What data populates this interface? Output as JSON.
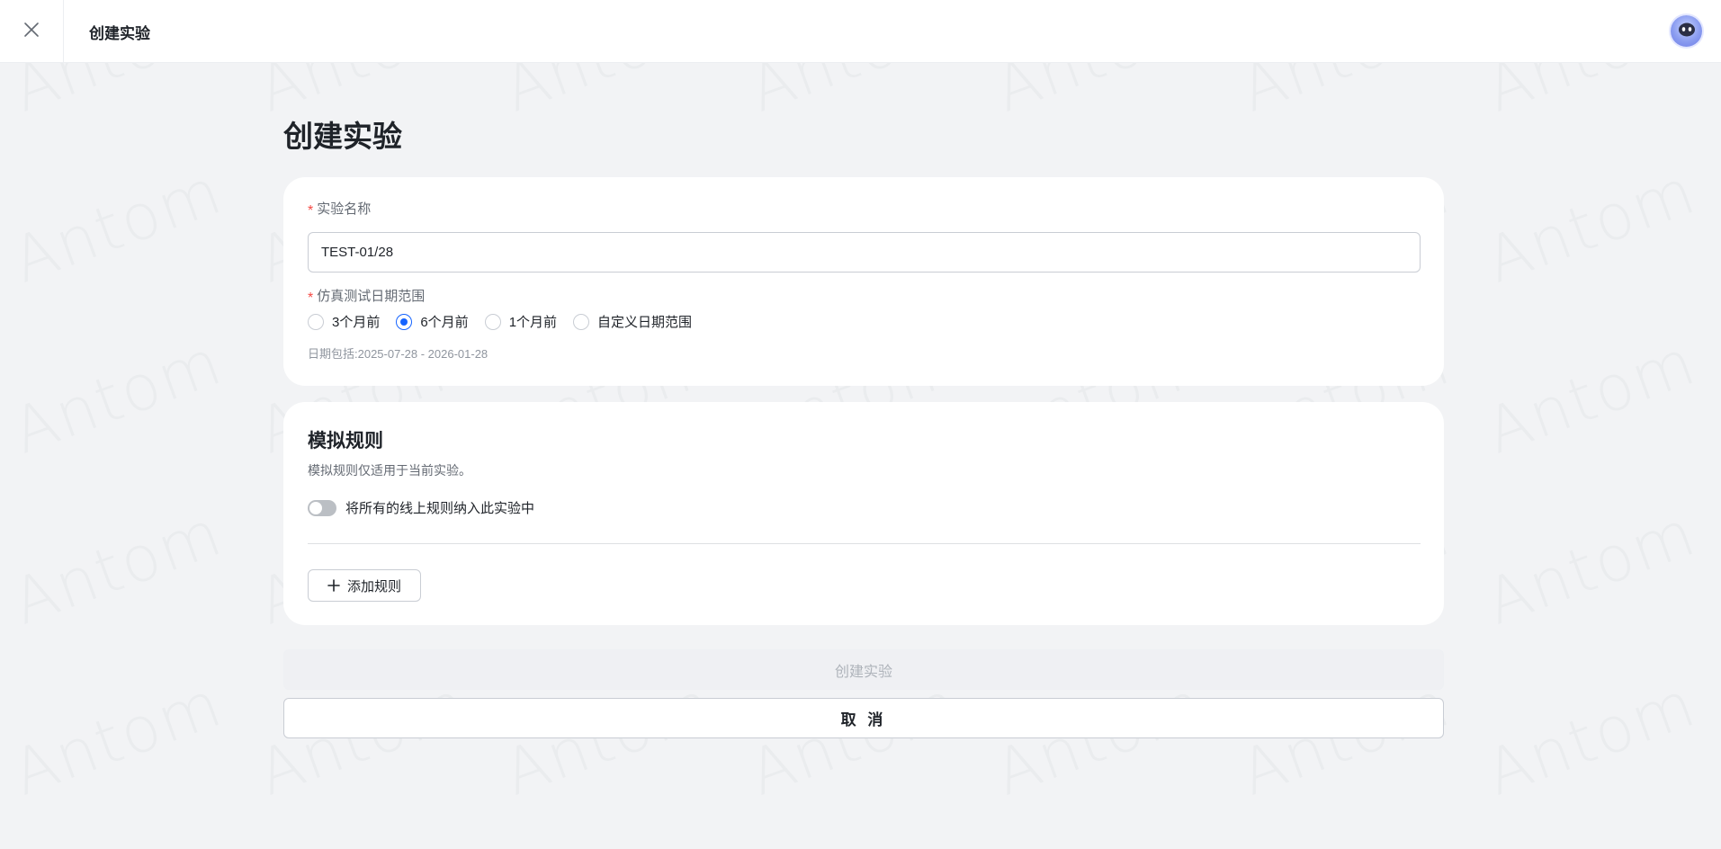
{
  "header": {
    "title": "创建实验"
  },
  "page": {
    "title": "创建实验"
  },
  "experiment_form": {
    "name_label": "实验名称",
    "name_value": "TEST-01/28",
    "date_range_label": "仿真测试日期范围",
    "date_options": [
      {
        "label": "3个月前",
        "selected": false
      },
      {
        "label": "6个月前",
        "selected": true
      },
      {
        "label": "1个月前",
        "selected": false
      },
      {
        "label": "自定义日期范围",
        "selected": false
      }
    ],
    "date_hint": "日期包括:2025-07-28 - 2026-01-28"
  },
  "rules_section": {
    "title": "模拟规则",
    "description": "模拟规则仅适用于当前实验。",
    "toggle_label": "将所有的线上规则纳入此实验中",
    "toggle_on": false,
    "add_rule_label": "添加规则"
  },
  "actions": {
    "create_label": "创建实验",
    "cancel_label": "取 消"
  },
  "watermark": {
    "text": "Antom"
  },
  "colors": {
    "accent": "#1664ff",
    "required": "#f54a45",
    "background": "#f2f3f5"
  }
}
